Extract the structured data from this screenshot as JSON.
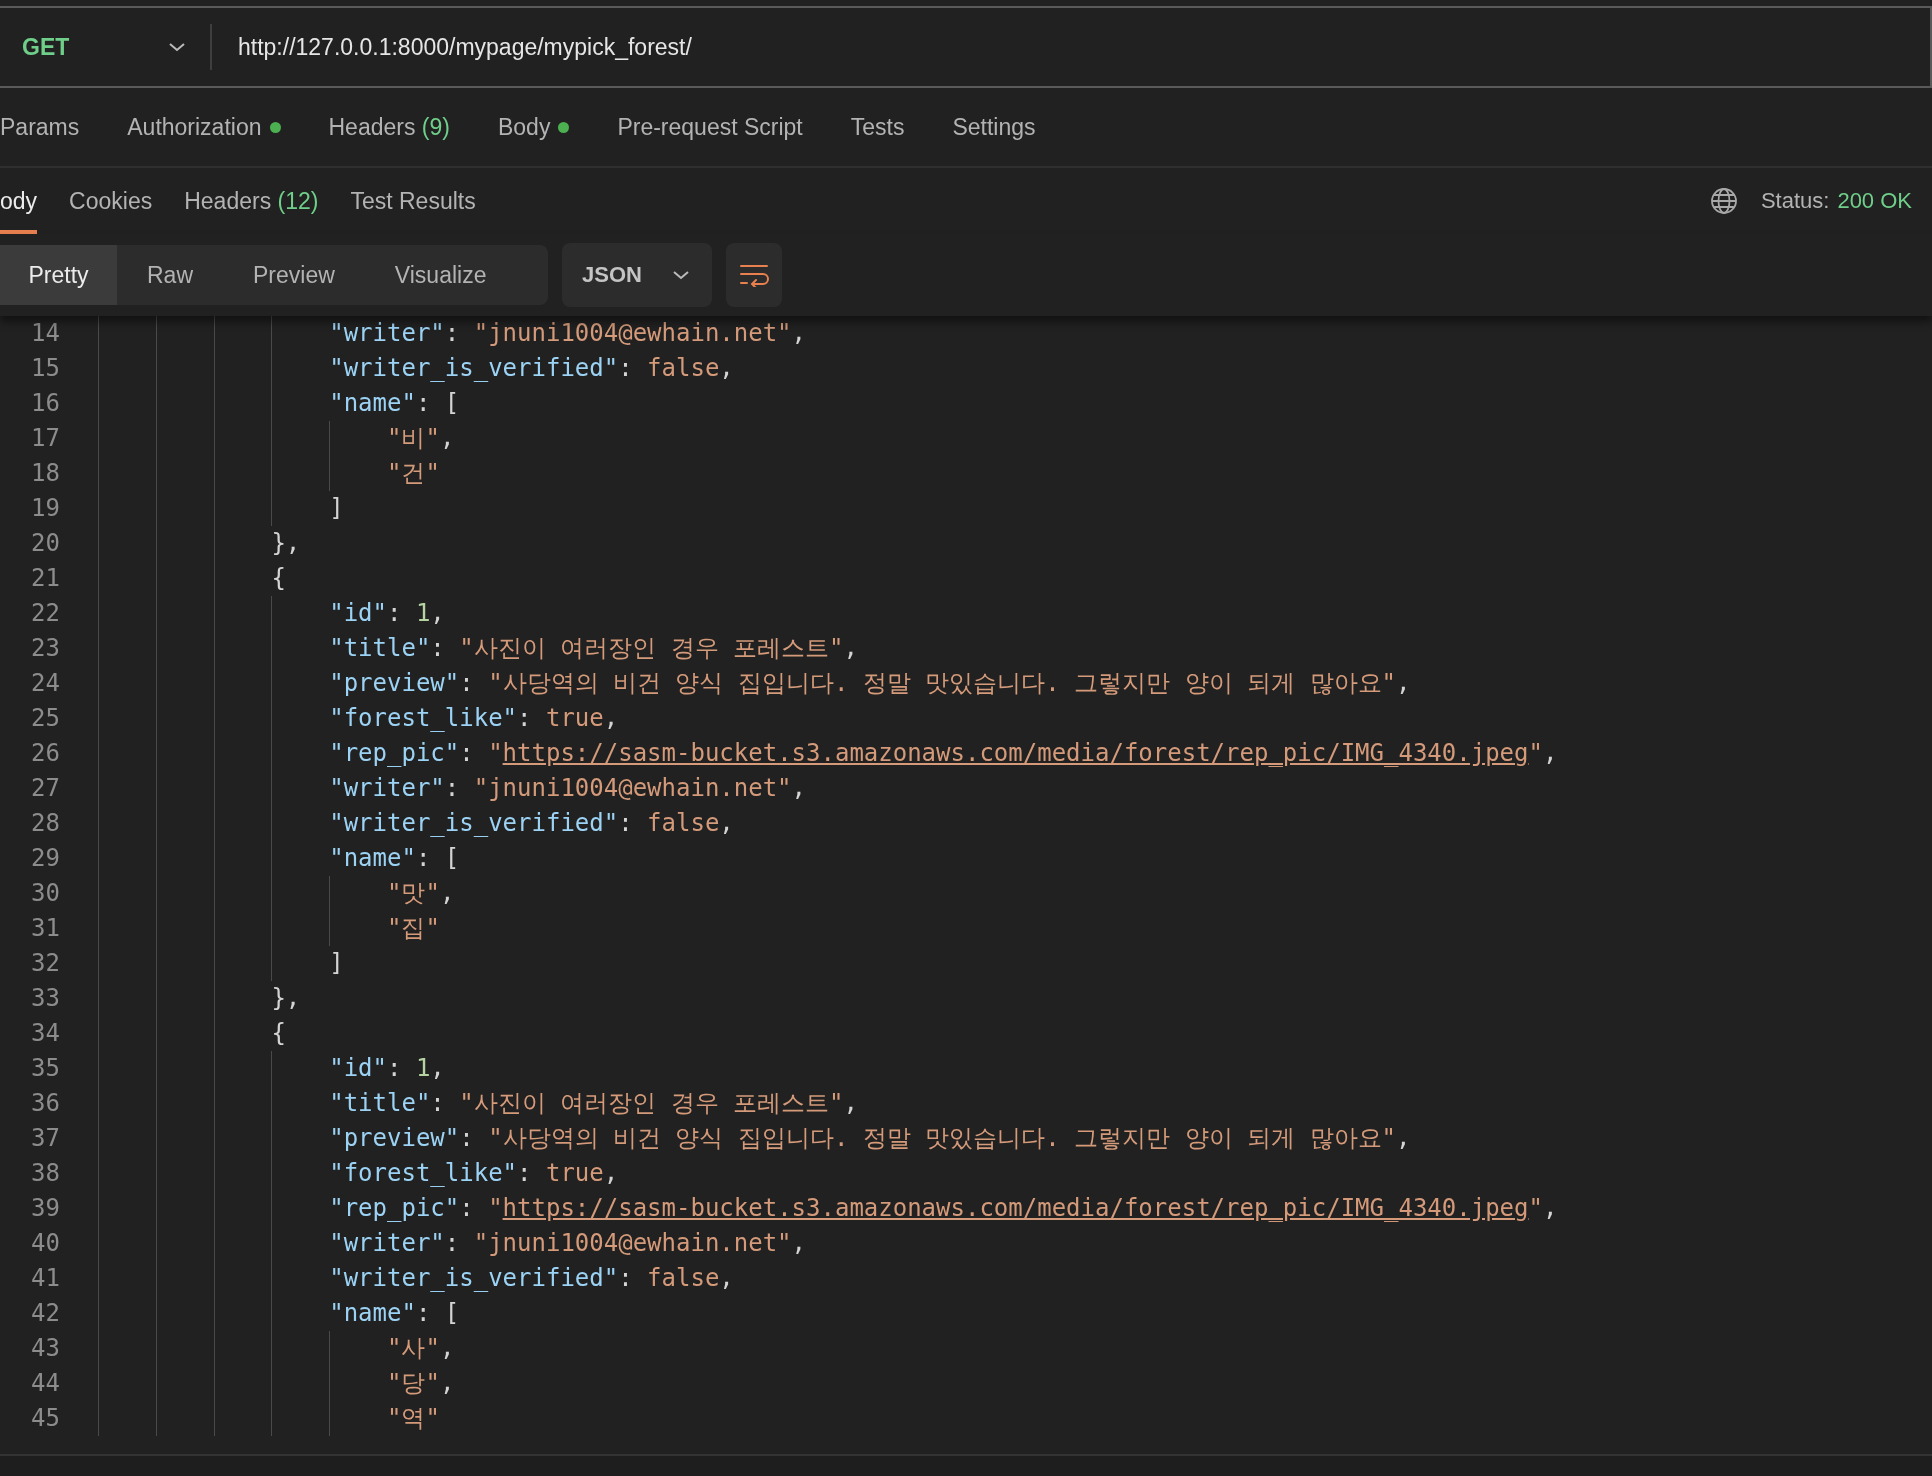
{
  "request": {
    "method": "GET",
    "url": "http://127.0.0.1:8000/mypage/mypick_forest/"
  },
  "request_tabs": [
    {
      "label": "Params"
    },
    {
      "label": "Authorization",
      "dot": true
    },
    {
      "label": "Headers",
      "count": "(9)"
    },
    {
      "label": "Body",
      "dot": true
    },
    {
      "label": "Pre-request Script"
    },
    {
      "label": "Tests"
    },
    {
      "label": "Settings"
    }
  ],
  "response_tabs": [
    {
      "label": "ody",
      "selected": true
    },
    {
      "label": "Cookies",
      "selected": false
    },
    {
      "label": "Headers",
      "count": "(12)",
      "selected": false
    },
    {
      "label": "Test Results",
      "selected": false
    }
  ],
  "status": {
    "label": "Status:",
    "value": "200 OK"
  },
  "view_modes": [
    {
      "label": "Pretty",
      "selected": true
    },
    {
      "label": "Raw",
      "selected": false
    },
    {
      "label": "Preview",
      "selected": false
    },
    {
      "label": "Visualize",
      "selected": false
    }
  ],
  "format": "JSON",
  "code_lines": [
    {
      "number": "14",
      "tokens": [
        {
          "kind": "key",
          "text": "                \"writer\""
        },
        {
          "kind": "punct",
          "text": ": "
        },
        {
          "kind": "string",
          "text": "\"jnuni1004@ewhain.net\""
        },
        {
          "kind": "punct",
          "text": ","
        }
      ]
    },
    {
      "number": "15",
      "tokens": [
        {
          "kind": "key",
          "text": "                \"writer_is_verified\""
        },
        {
          "kind": "punct",
          "text": ": "
        },
        {
          "kind": "bool",
          "text": "false"
        },
        {
          "kind": "punct",
          "text": ","
        }
      ]
    },
    {
      "number": "16",
      "tokens": [
        {
          "kind": "key",
          "text": "                \"name\""
        },
        {
          "kind": "punct",
          "text": ": ["
        }
      ]
    },
    {
      "number": "17",
      "tokens": [
        {
          "kind": "string",
          "text": "                    \"비\""
        },
        {
          "kind": "punct",
          "text": ","
        }
      ]
    },
    {
      "number": "18",
      "tokens": [
        {
          "kind": "string",
          "text": "                    \"건\""
        }
      ]
    },
    {
      "number": "19",
      "tokens": [
        {
          "kind": "punct",
          "text": "                ]"
        }
      ]
    },
    {
      "number": "20",
      "tokens": [
        {
          "kind": "punct",
          "text": "            },"
        }
      ]
    },
    {
      "number": "21",
      "tokens": [
        {
          "kind": "punct",
          "text": "            {"
        }
      ]
    },
    {
      "number": "22",
      "tokens": [
        {
          "kind": "key",
          "text": "                \"id\""
        },
        {
          "kind": "punct",
          "text": ": "
        },
        {
          "kind": "number",
          "text": "1"
        },
        {
          "kind": "punct",
          "text": ","
        }
      ]
    },
    {
      "number": "23",
      "tokens": [
        {
          "kind": "key",
          "text": "                \"title\""
        },
        {
          "kind": "punct",
          "text": ": "
        },
        {
          "kind": "string",
          "text": "\"사진이 여러장인 경우 포레스트\""
        },
        {
          "kind": "punct",
          "text": ","
        }
      ]
    },
    {
      "number": "24",
      "tokens": [
        {
          "kind": "key",
          "text": "                \"preview\""
        },
        {
          "kind": "punct",
          "text": ": "
        },
        {
          "kind": "string",
          "text": "\"사당역의 비건 양식 집입니다. 정말 맛있습니다. 그렇지만 양이 되게 많아요\""
        },
        {
          "kind": "punct",
          "text": ","
        }
      ]
    },
    {
      "number": "25",
      "tokens": [
        {
          "kind": "key",
          "text": "                \"forest_like\""
        },
        {
          "kind": "punct",
          "text": ": "
        },
        {
          "kind": "bool",
          "text": "true"
        },
        {
          "kind": "punct",
          "text": ","
        }
      ]
    },
    {
      "number": "26",
      "tokens": [
        {
          "kind": "key",
          "text": "                \"rep_pic\""
        },
        {
          "kind": "punct",
          "text": ": "
        },
        {
          "kind": "string",
          "text": "\""
        },
        {
          "kind": "link",
          "text": "https://sasm-bucket.s3.amazonaws.com/media/forest/rep_pic/IMG_4340.jpeg"
        },
        {
          "kind": "string",
          "text": "\""
        },
        {
          "kind": "punct",
          "text": ","
        }
      ]
    },
    {
      "number": "27",
      "tokens": [
        {
          "kind": "key",
          "text": "                \"writer\""
        },
        {
          "kind": "punct",
          "text": ": "
        },
        {
          "kind": "string",
          "text": "\"jnuni1004@ewhain.net\""
        },
        {
          "kind": "punct",
          "text": ","
        }
      ]
    },
    {
      "number": "28",
      "tokens": [
        {
          "kind": "key",
          "text": "                \"writer_is_verified\""
        },
        {
          "kind": "punct",
          "text": ": "
        },
        {
          "kind": "bool",
          "text": "false"
        },
        {
          "kind": "punct",
          "text": ","
        }
      ]
    },
    {
      "number": "29",
      "tokens": [
        {
          "kind": "key",
          "text": "                \"name\""
        },
        {
          "kind": "punct",
          "text": ": ["
        }
      ]
    },
    {
      "number": "30",
      "tokens": [
        {
          "kind": "string",
          "text": "                    \"맛\""
        },
        {
          "kind": "punct",
          "text": ","
        }
      ]
    },
    {
      "number": "31",
      "tokens": [
        {
          "kind": "string",
          "text": "                    \"집\""
        }
      ]
    },
    {
      "number": "32",
      "tokens": [
        {
          "kind": "punct",
          "text": "                ]"
        }
      ]
    },
    {
      "number": "33",
      "tokens": [
        {
          "kind": "punct",
          "text": "            },"
        }
      ]
    },
    {
      "number": "34",
      "tokens": [
        {
          "kind": "punct",
          "text": "            {"
        }
      ]
    },
    {
      "number": "35",
      "tokens": [
        {
          "kind": "key",
          "text": "                \"id\""
        },
        {
          "kind": "punct",
          "text": ": "
        },
        {
          "kind": "number",
          "text": "1"
        },
        {
          "kind": "punct",
          "text": ","
        }
      ]
    },
    {
      "number": "36",
      "tokens": [
        {
          "kind": "key",
          "text": "                \"title\""
        },
        {
          "kind": "punct",
          "text": ": "
        },
        {
          "kind": "string",
          "text": "\"사진이 여러장인 경우 포레스트\""
        },
        {
          "kind": "punct",
          "text": ","
        }
      ]
    },
    {
      "number": "37",
      "tokens": [
        {
          "kind": "key",
          "text": "                \"preview\""
        },
        {
          "kind": "punct",
          "text": ": "
        },
        {
          "kind": "string",
          "text": "\"사당역의 비건 양식 집입니다. 정말 맛있습니다. 그렇지만 양이 되게 많아요\""
        },
        {
          "kind": "punct",
          "text": ","
        }
      ]
    },
    {
      "number": "38",
      "tokens": [
        {
          "kind": "key",
          "text": "                \"forest_like\""
        },
        {
          "kind": "punct",
          "text": ": "
        },
        {
          "kind": "bool",
          "text": "true"
        },
        {
          "kind": "punct",
          "text": ","
        }
      ]
    },
    {
      "number": "39",
      "tokens": [
        {
          "kind": "key",
          "text": "                \"rep_pic\""
        },
        {
          "kind": "punct",
          "text": ": "
        },
        {
          "kind": "string",
          "text": "\""
        },
        {
          "kind": "link",
          "text": "https://sasm-bucket.s3.amazonaws.com/media/forest/rep_pic/IMG_4340.jpeg"
        },
        {
          "kind": "string",
          "text": "\""
        },
        {
          "kind": "punct",
          "text": ","
        }
      ]
    },
    {
      "number": "40",
      "tokens": [
        {
          "kind": "key",
          "text": "                \"writer\""
        },
        {
          "kind": "punct",
          "text": ": "
        },
        {
          "kind": "string",
          "text": "\"jnuni1004@ewhain.net\""
        },
        {
          "kind": "punct",
          "text": ","
        }
      ]
    },
    {
      "number": "41",
      "tokens": [
        {
          "kind": "key",
          "text": "                \"writer_is_verified\""
        },
        {
          "kind": "punct",
          "text": ": "
        },
        {
          "kind": "bool",
          "text": "false"
        },
        {
          "kind": "punct",
          "text": ","
        }
      ]
    },
    {
      "number": "42",
      "tokens": [
        {
          "kind": "key",
          "text": "                \"name\""
        },
        {
          "kind": "punct",
          "text": ": ["
        }
      ]
    },
    {
      "number": "43",
      "tokens": [
        {
          "kind": "string",
          "text": "                    \"사\""
        },
        {
          "kind": "punct",
          "text": ","
        }
      ]
    },
    {
      "number": "44",
      "tokens": [
        {
          "kind": "string",
          "text": "                    \"당\""
        },
        {
          "kind": "punct",
          "text": ","
        }
      ]
    },
    {
      "number": "45",
      "tokens": [
        {
          "kind": "string",
          "text": "                    \"역\""
        }
      ]
    }
  ]
}
